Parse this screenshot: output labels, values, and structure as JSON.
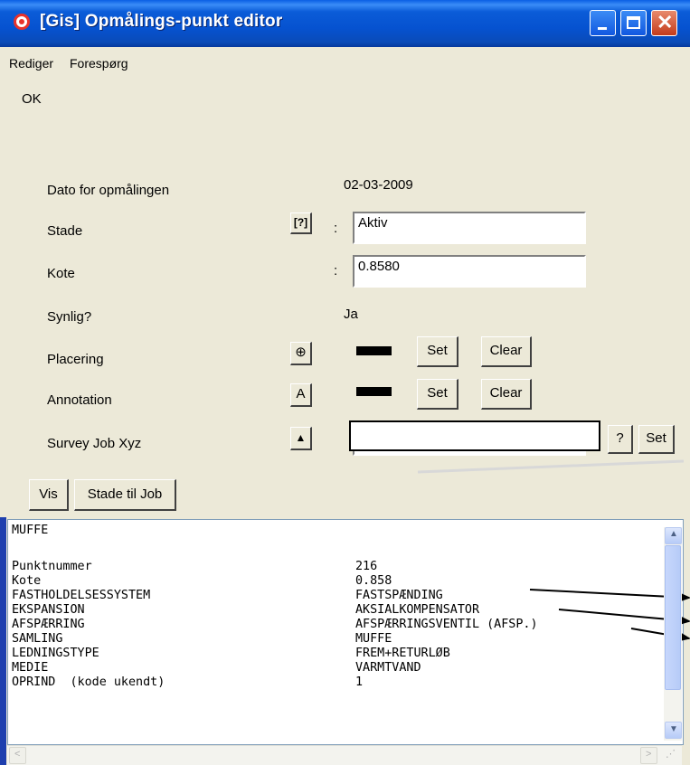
{
  "window": {
    "title": "[Gis] Opmålings-punkt editor"
  },
  "menu": {
    "items": [
      "Rediger",
      "Forespørg"
    ]
  },
  "status": "OK",
  "form": {
    "dato_label": "Dato for opmålingen",
    "dato_value": "02-03-2009",
    "stade_label": "Stade",
    "stade_value": "Aktiv",
    "kote_label": "Kote",
    "kote_value": "0.8580",
    "synlig_label": "Synlig?",
    "synlig_value": "Ja",
    "placering_label": "Placering",
    "annotation_label": "Annotation",
    "survey_label": "Survey Job Xyz",
    "colon": ":",
    "set_label": "Set",
    "clear_label": "Clear",
    "question_label": "?"
  },
  "buttons": {
    "vis": "Vis",
    "stade_til_job": "Stade til Job"
  },
  "info": {
    "heading": "MUFFE",
    "rows": [
      {
        "key": "Punktnummer",
        "value": "216"
      },
      {
        "key": "Kote",
        "value": "0.858"
      },
      {
        "key": "FASTHOLDELSESSYSTEM",
        "value": "FASTSPÆNDING"
      },
      {
        "key": "EKSPANSION",
        "value": "AKSIALKOMPENSATOR"
      },
      {
        "key": "AFSPÆRRING",
        "value": "AFSPÆRRINGSVENTIL (AFSP.)"
      },
      {
        "key": "SAMLING",
        "value": "MUFFE"
      },
      {
        "key": "LEDNINGSTYPE",
        "value": "FREM+RETURLØB"
      },
      {
        "key": "MEDIE",
        "value": "VARMTVAND"
      },
      {
        "key": "OPRIND  (kode ukendt)",
        "value": "1"
      }
    ]
  },
  "icons": [
    "app-icon",
    "lookup-icon",
    "crosshair-icon",
    "annotation-icon",
    "triangle-up-icon"
  ]
}
